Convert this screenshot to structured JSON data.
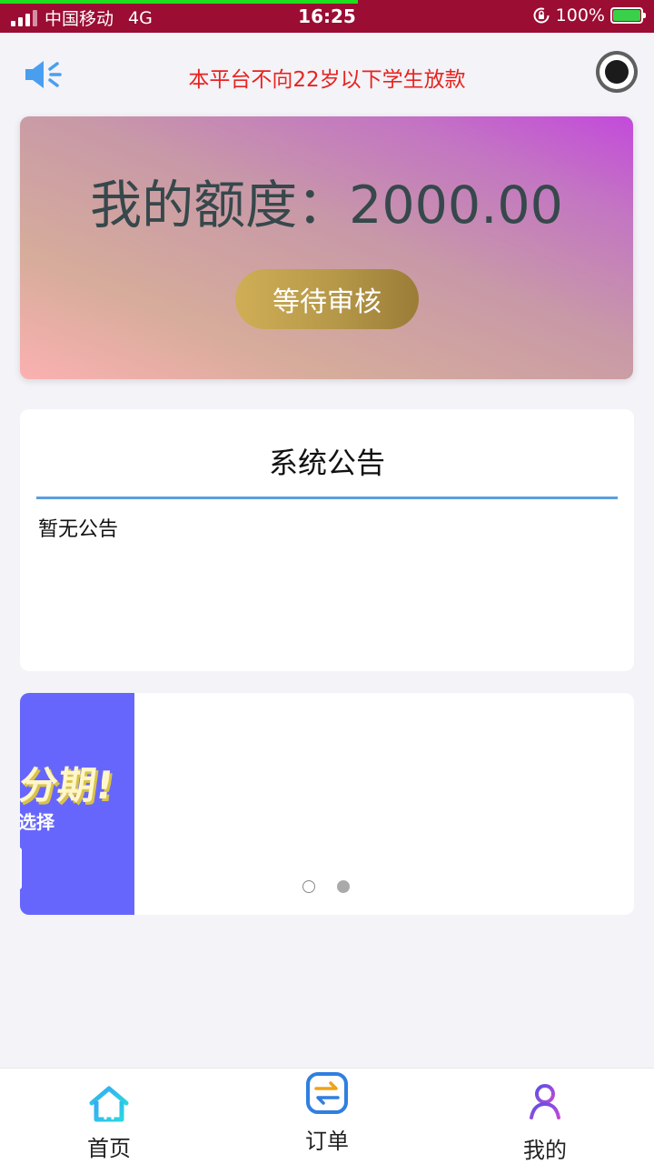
{
  "status_bar": {
    "carrier": "中国移动",
    "network": "4G",
    "time": "16:25",
    "battery": "100%",
    "colors": {
      "background": "#9b0d33",
      "progress": "#1ee01e"
    }
  },
  "top_notice": {
    "text": "本平台不向22岁以下学生放款",
    "color": "#e8231f"
  },
  "quota_card": {
    "label": "我的额度：",
    "amount": "2000.00",
    "status_button": "等待审核"
  },
  "announcement": {
    "title": "系统公告",
    "content": "暂无公告",
    "divider_color": "#5b9fde"
  },
  "banner": {
    "headline": "分期!",
    "subline": "选择",
    "background": "#6766fc",
    "page_indicator": {
      "count": 2,
      "active_index": 1
    }
  },
  "bottom_nav": {
    "items": [
      {
        "label": "首页",
        "icon": "home-icon"
      },
      {
        "label": "订单",
        "icon": "exchange-icon"
      },
      {
        "label": "我的",
        "icon": "user-icon"
      }
    ]
  }
}
